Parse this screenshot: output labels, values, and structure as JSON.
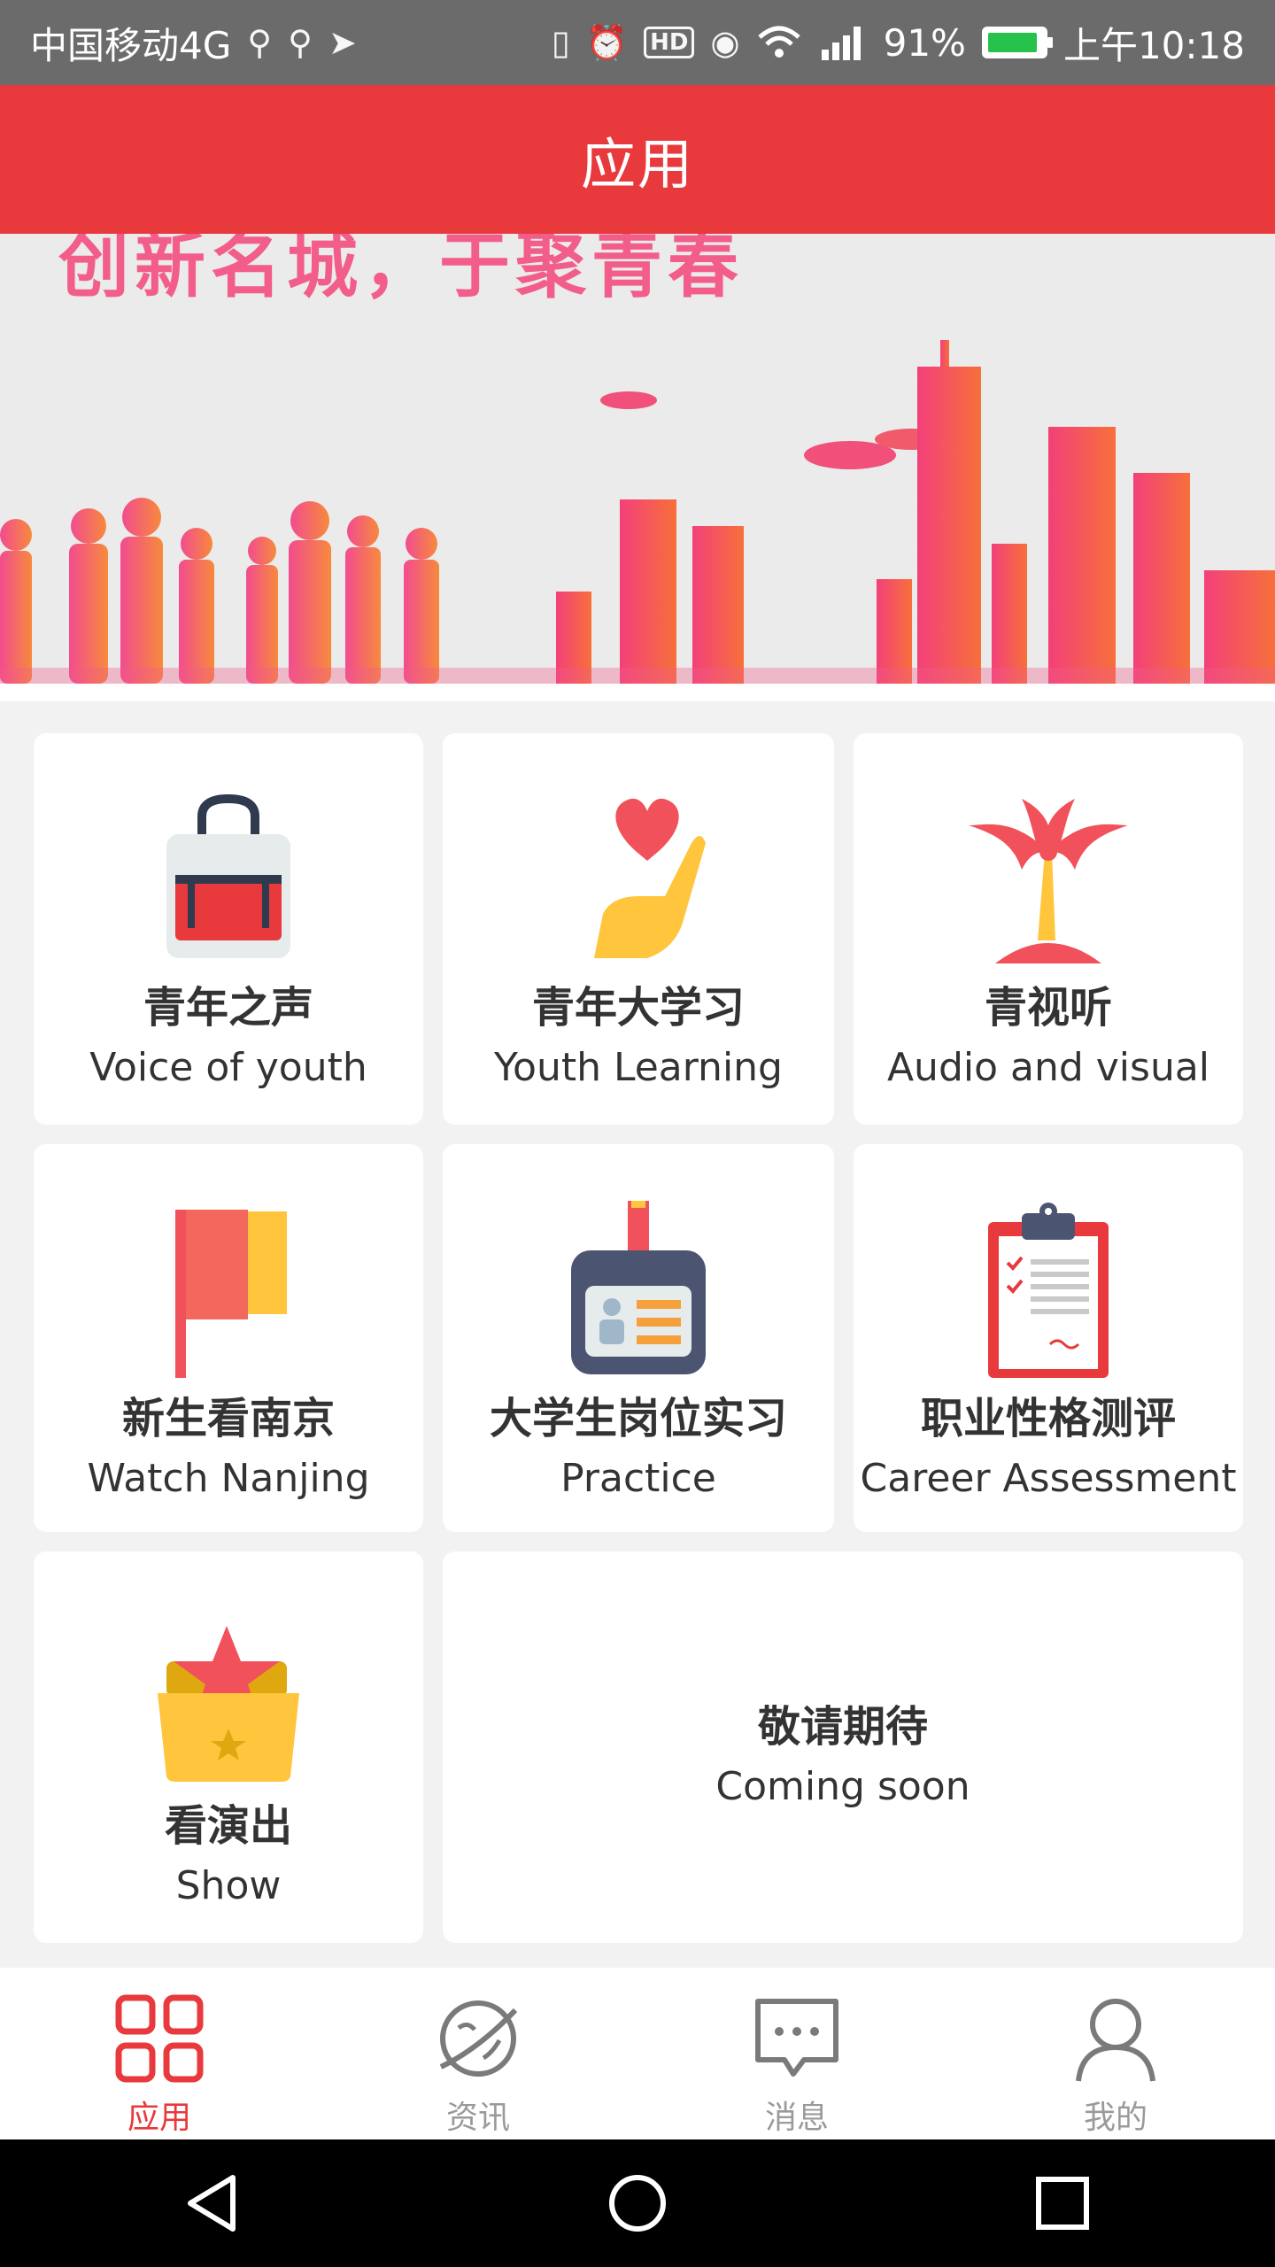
{
  "status_bar": {
    "carrier": "中国移动4G",
    "battery": "91%",
    "time": "上午10:18",
    "icons": [
      "usb-icon",
      "usb-icon",
      "send-icon",
      "vibrate-icon",
      "alarm-icon",
      "hd-icon",
      "eye-icon",
      "wifi-icon",
      "signal-icon",
      "battery-icon"
    ]
  },
  "header": {
    "title": "应用"
  },
  "banner": {
    "slogan": "创新名城，于聚青春"
  },
  "tiles": [
    {
      "title": "青年之声",
      "subtitle": "Voice of youth",
      "icon": "bag-icon"
    },
    {
      "title": "青年大学习",
      "subtitle": "Youth Learning",
      "icon": "heart-hand-icon"
    },
    {
      "title": "青视听",
      "subtitle": "Audio and visual",
      "icon": "palm-tree-icon"
    },
    {
      "title": "新生看南京",
      "subtitle": "Watch Nanjing",
      "icon": "flag-icon"
    },
    {
      "title": "大学生岗位实习",
      "subtitle": "Practice",
      "icon": "id-badge-icon"
    },
    {
      "title": "职业性格测评",
      "subtitle": "Career Assessment",
      "icon": "clipboard-icon"
    },
    {
      "title": "看演出",
      "subtitle": "Show",
      "icon": "star-folder-icon"
    },
    {
      "title": "敬请期待",
      "subtitle": "Coming soon"
    }
  ],
  "tabs": [
    {
      "label": "应用",
      "icon": "apps-grid-icon",
      "active": true
    },
    {
      "label": "资讯",
      "icon": "planet-icon",
      "active": false
    },
    {
      "label": "消息",
      "icon": "message-icon",
      "active": false
    },
    {
      "label": "我的",
      "icon": "user-icon",
      "active": false
    }
  ],
  "nav": [
    "back-icon",
    "home-icon",
    "recents-icon"
  ],
  "colors": {
    "brand": "#e8393c",
    "inactive": "#9a9a9a"
  }
}
